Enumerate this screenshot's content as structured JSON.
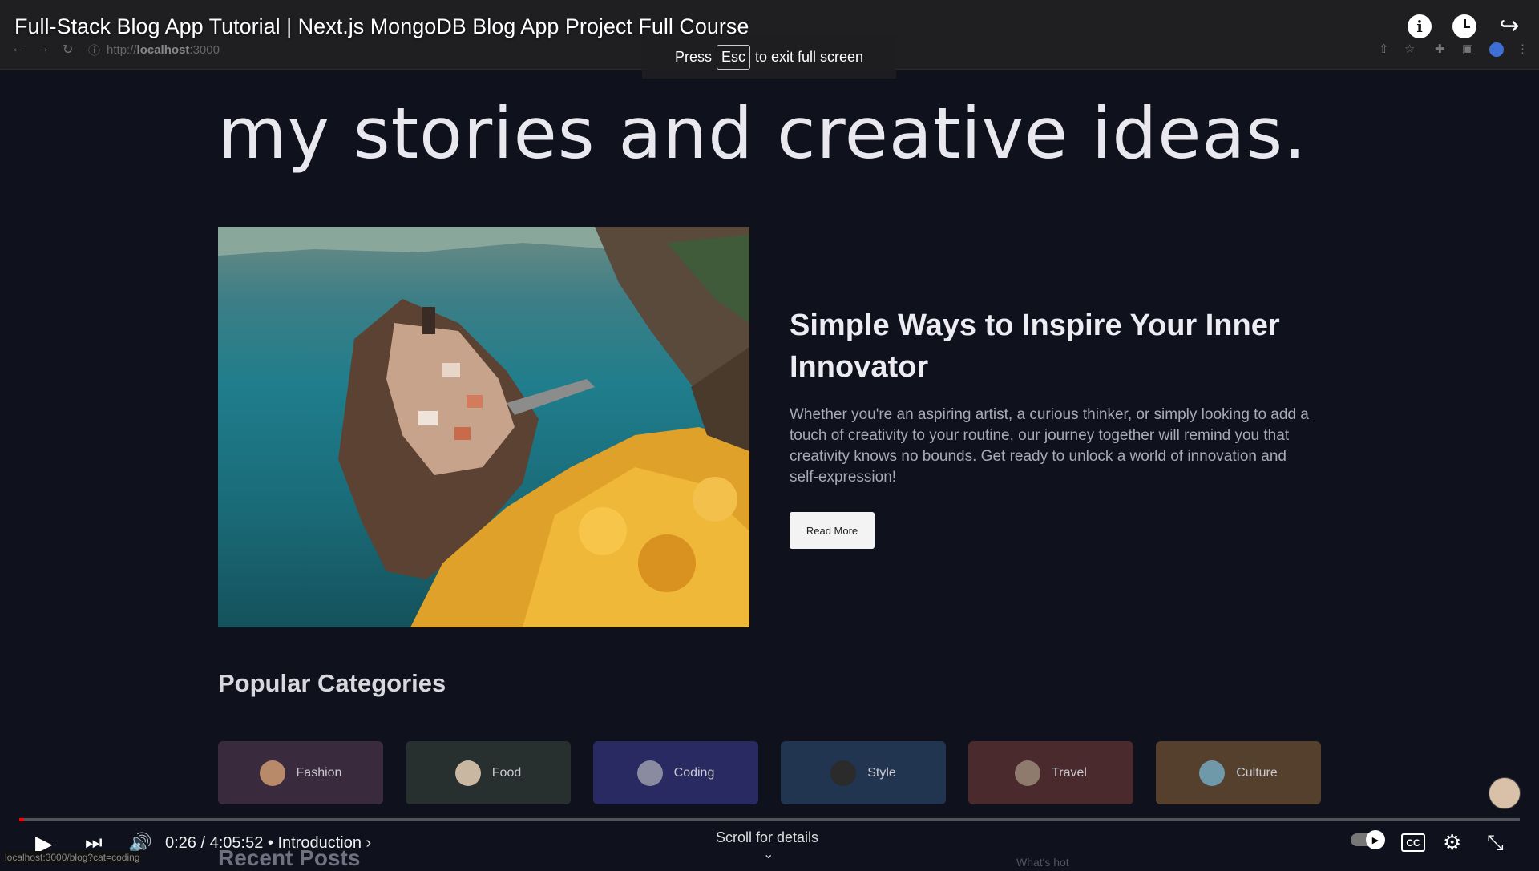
{
  "video": {
    "title": "Full-Stack Blog App Tutorial | Next.js MongoDB Blog App Project Full Course",
    "time": "0:26 / 4:05:52",
    "chapter": "• Introduction ›",
    "scroll_hint": "Scroll for details",
    "progress": 0.0018,
    "icons": [
      "info-icon",
      "clock-icon",
      "share-icon",
      "play-icon",
      "next-icon",
      "volume-icon",
      "autoplay-toggle",
      "cc-icon",
      "settings-icon",
      "exit-fullscreen-icon"
    ]
  },
  "fullscreen_toast": {
    "press": "Press",
    "key": "Esc",
    "rest": "to exit full screen"
  },
  "browser": {
    "url_scheme": "http://",
    "url_host": "localhost",
    "url_port": ":3000",
    "status_url": "localhost:3000/blog?cat=coding"
  },
  "blog": {
    "hero_heading": "my stories and creative ideas.",
    "featured": {
      "title": "Simple Ways to Inspire Your Inner Innovator",
      "description": "Whether you're an aspiring artist, a curious thinker, or simply looking to add a touch of creativity to your routine, our journey together will remind you that creativity knows no bounds. Get ready to unlock a world of innovation and self-expression!",
      "cta": "Read More"
    },
    "popular_heading": "Popular Categories",
    "categories": [
      {
        "label": "Fashion",
        "bg": "#3a2a3e",
        "ava": "#b98a6a"
      },
      {
        "label": "Food",
        "bg": "#27302f",
        "ava": "#c9b7a2"
      },
      {
        "label": "Coding",
        "bg": "#2a2a63",
        "ava": "#8a8aa0"
      },
      {
        "label": "Style",
        "bg": "#213450",
        "ava": "#2b2b2b"
      },
      {
        "label": "Travel",
        "bg": "#4a2a2c",
        "ava": "#8e7b6e"
      },
      {
        "label": "Culture",
        "bg": "#55402e",
        "ava": "#6f98a8"
      }
    ],
    "recent_heading": "Recent Posts",
    "whats_hot": "What's hot"
  }
}
